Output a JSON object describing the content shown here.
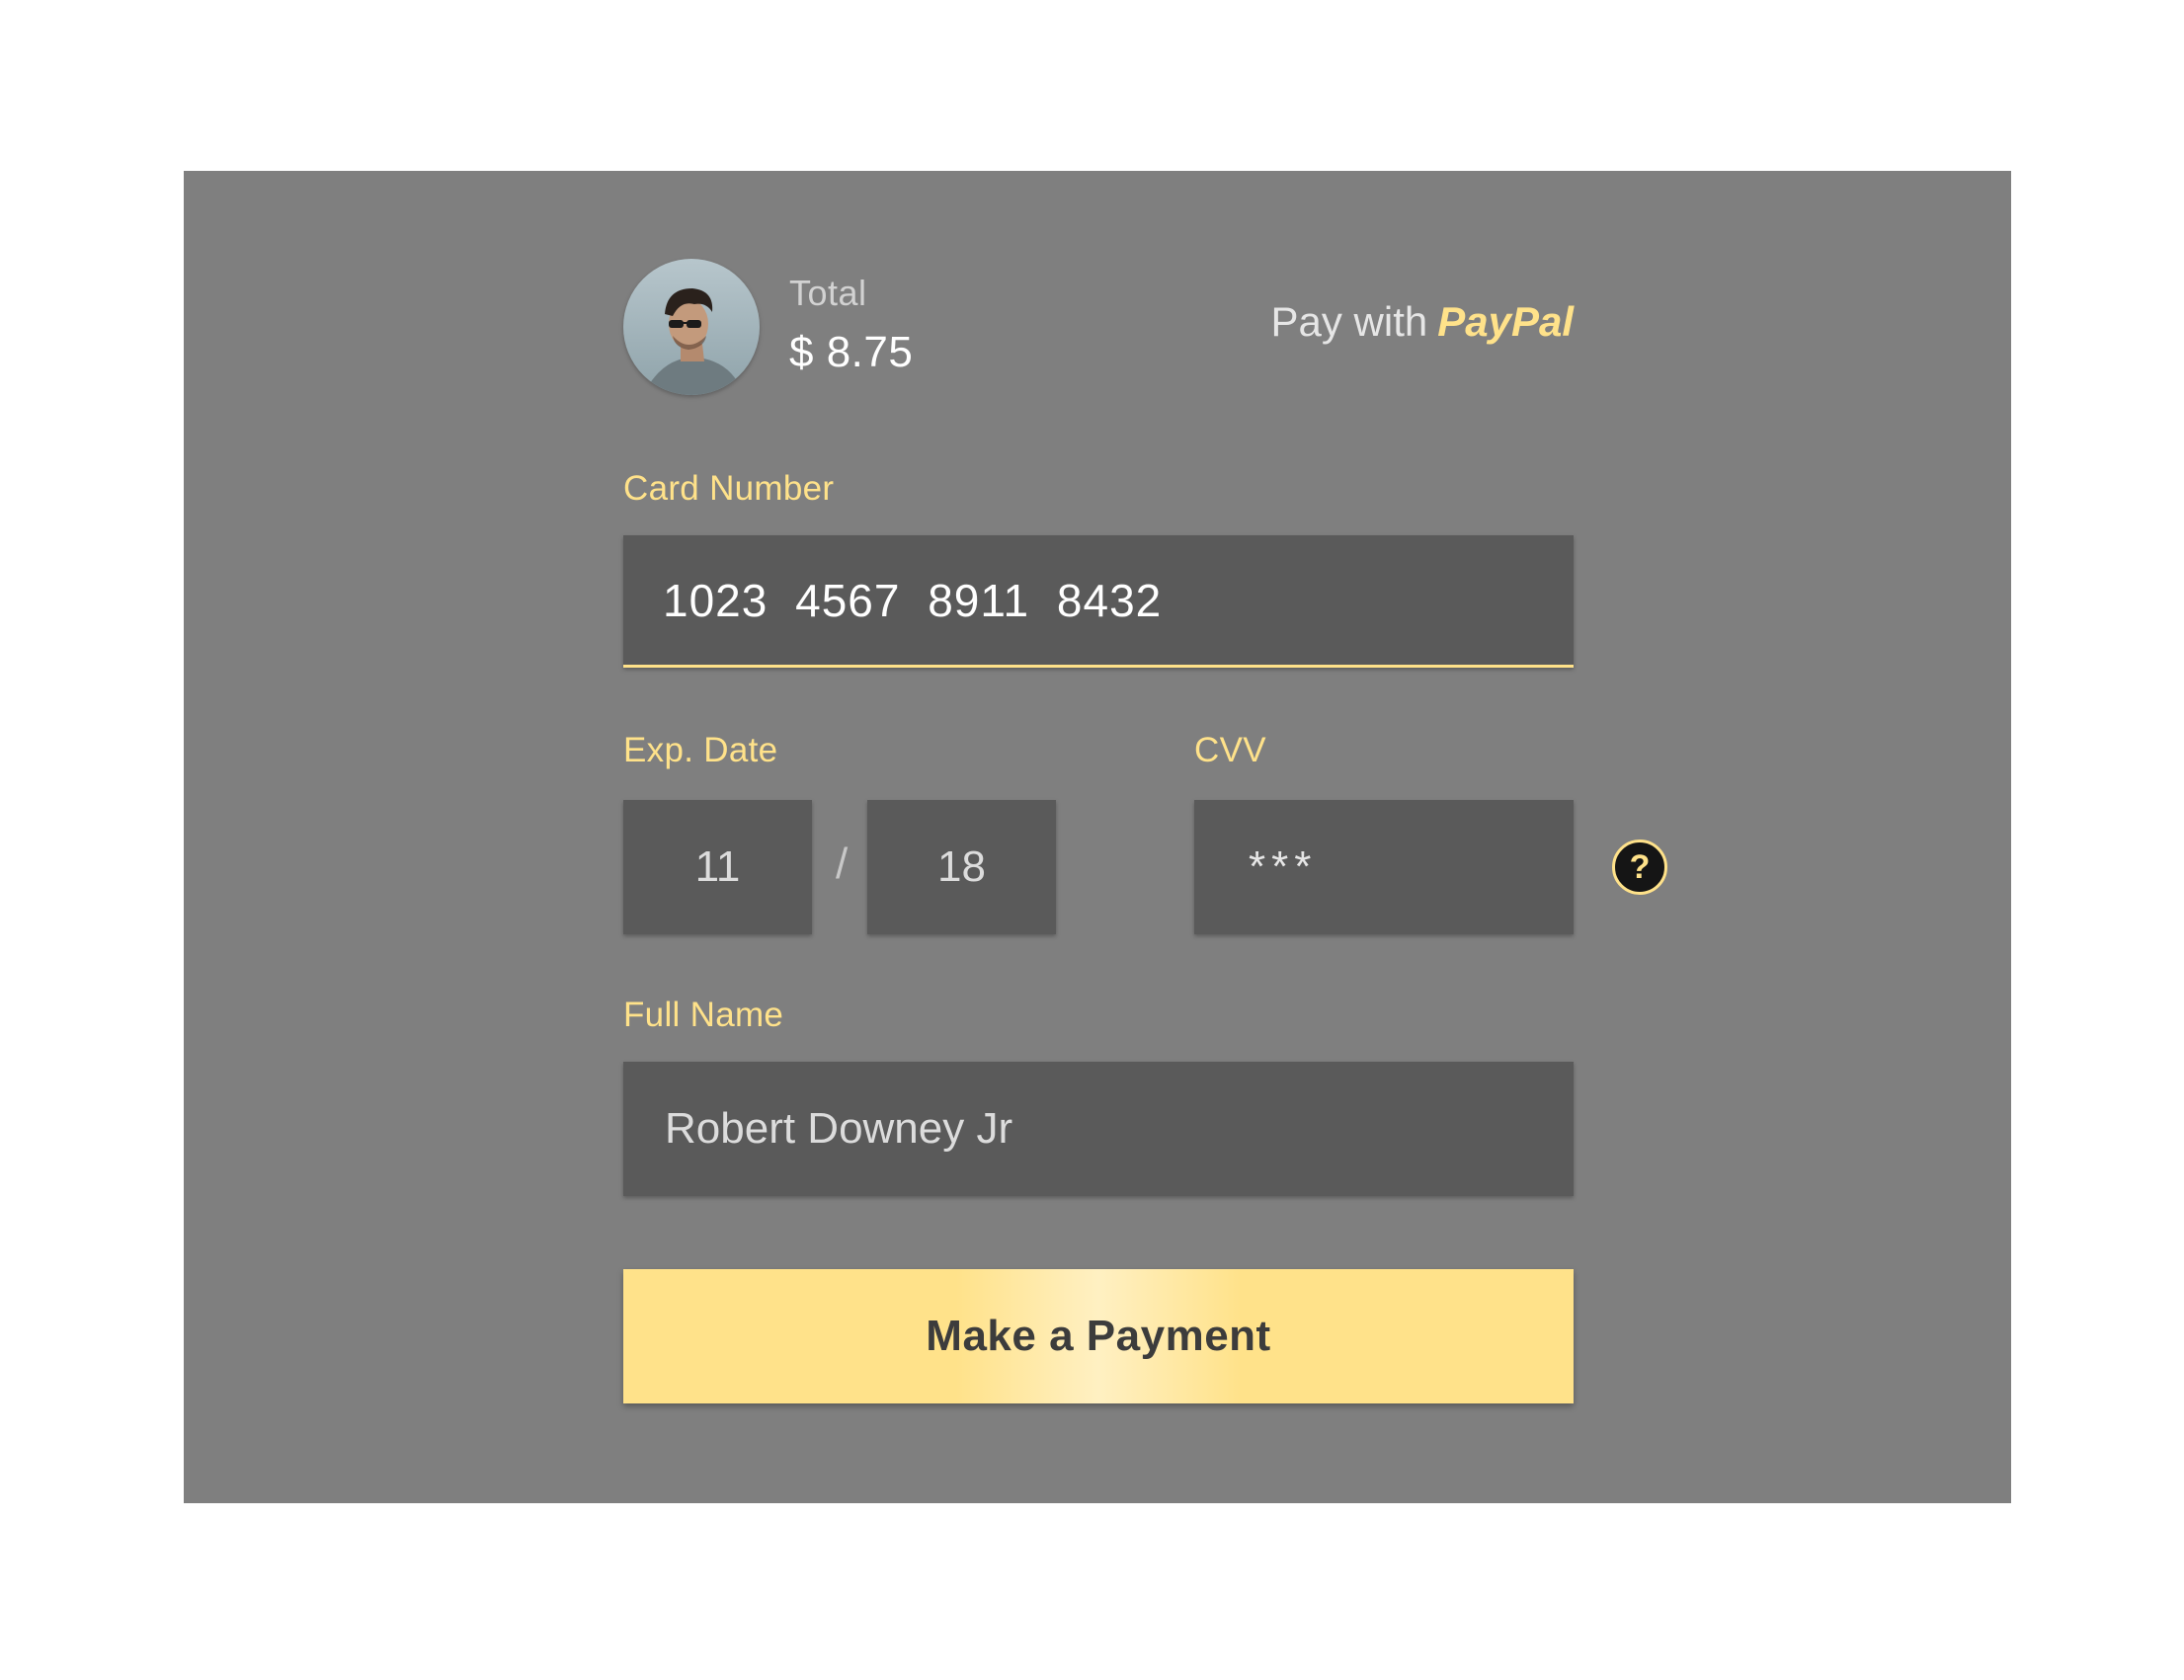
{
  "header": {
    "total_label": "Total",
    "total_amount": "$ 8.75",
    "pay_with_label": "Pay with",
    "pay_with_brand": "PayPal"
  },
  "card_number": {
    "label": "Card Number",
    "value": "1023 4567 8911 8432"
  },
  "expiry": {
    "label": "Exp. Date",
    "month": "11",
    "separator": "/",
    "year": "18"
  },
  "cvv": {
    "label": "CVV",
    "value": "***",
    "help_symbol": "?"
  },
  "full_name": {
    "label": "Full Name",
    "value": "Robert Downey Jr"
  },
  "submit": {
    "label": "Make a Payment"
  },
  "colors": {
    "panel_background": "#7f7f7f",
    "input_background": "#5a5a5a",
    "accent": "#ffe28a",
    "help_icon_background": "#151515"
  },
  "icons": {
    "help": "question-mark-circle-icon",
    "avatar": "user-avatar-photo"
  }
}
